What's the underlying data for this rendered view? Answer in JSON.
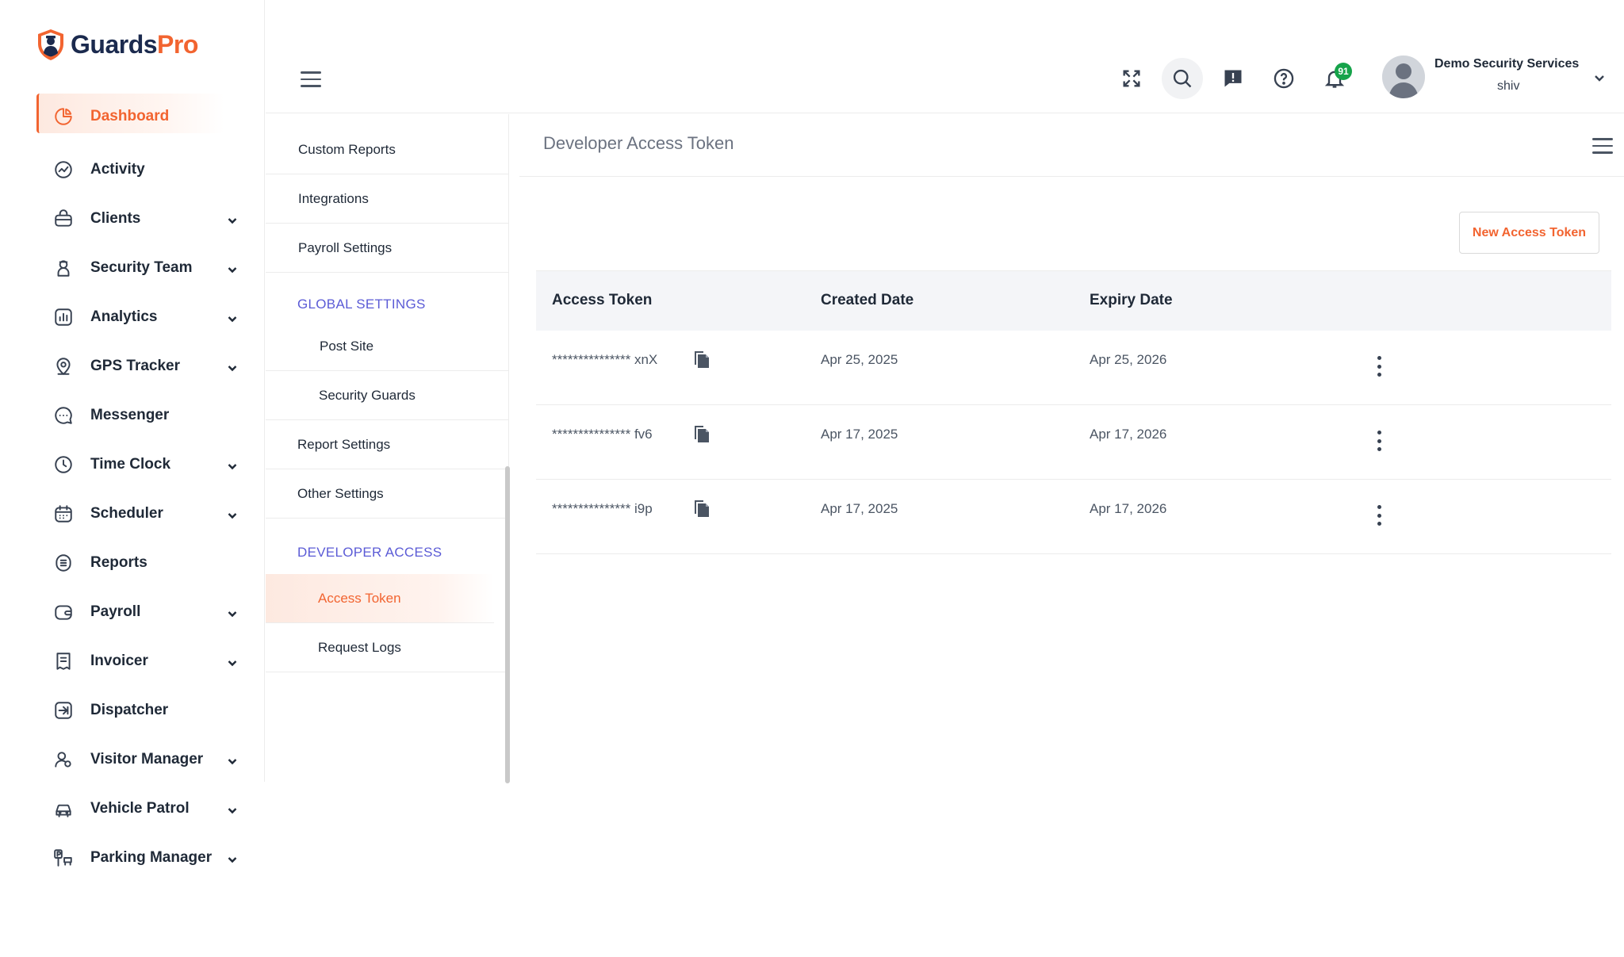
{
  "brand": {
    "name_part1": "Guards",
    "name_part2": "Pro"
  },
  "sidebar": {
    "items": [
      {
        "label": "Dashboard",
        "icon": "dashboard-icon",
        "has_chevron": false,
        "active": true
      },
      {
        "label": "Activity",
        "icon": "activity-icon",
        "has_chevron": false
      },
      {
        "label": "Clients",
        "icon": "clients-icon",
        "has_chevron": true
      },
      {
        "label": "Security Team",
        "icon": "security-team-icon",
        "has_chevron": true
      },
      {
        "label": "Analytics",
        "icon": "analytics-icon",
        "has_chevron": true
      },
      {
        "label": "GPS Tracker",
        "icon": "gps-pin-icon",
        "has_chevron": true
      },
      {
        "label": "Messenger",
        "icon": "chat-bubble-icon",
        "has_chevron": false
      },
      {
        "label": "Time Clock",
        "icon": "clock-icon",
        "has_chevron": true
      },
      {
        "label": "Scheduler",
        "icon": "calendar-icon",
        "has_chevron": true
      },
      {
        "label": "Reports",
        "icon": "report-icon",
        "has_chevron": false
      },
      {
        "label": "Payroll",
        "icon": "wallet-icon",
        "has_chevron": true
      },
      {
        "label": "Invoicer",
        "icon": "invoice-icon",
        "has_chevron": true
      },
      {
        "label": "Dispatcher",
        "icon": "dispatch-icon",
        "has_chevron": false
      },
      {
        "label": "Visitor Manager",
        "icon": "visitor-icon",
        "has_chevron": true
      },
      {
        "label": "Vehicle Patrol",
        "icon": "car-icon",
        "has_chevron": true
      },
      {
        "label": "Parking Manager",
        "icon": "parking-icon",
        "has_chevron": true
      }
    ]
  },
  "header": {
    "user_name": "Demo Security Services",
    "user_sub": "shiv",
    "notification_count": "91"
  },
  "settings_menu": {
    "items_top": [
      "Custom Reports",
      "Integrations",
      "Payroll Settings"
    ],
    "global_heading": "GLOBAL SETTINGS",
    "global_items": [
      "Post Site",
      "Security Guards"
    ],
    "items_mid": [
      "Report Settings",
      "Other Settings"
    ],
    "developer_heading": "DEVELOPER ACCESS",
    "developer_items": [
      "Access Token",
      "Request Logs"
    ],
    "active_item": "Access Token"
  },
  "main": {
    "title": "Developer Access Token",
    "new_button": "New Access Token",
    "columns": [
      "Access Token",
      "Created Date",
      "Expiry Date"
    ],
    "rows": [
      {
        "token": "*************** xnX",
        "created": "Apr 25, 2025",
        "expiry": "Apr 25, 2026"
      },
      {
        "token": "*************** fv6",
        "created": "Apr 17, 2025",
        "expiry": "Apr 17, 2026"
      },
      {
        "token": "*************** i9p",
        "created": "Apr 17, 2025",
        "expiry": "Apr 17, 2026"
      }
    ]
  },
  "colors": {
    "accent": "#f26430",
    "brand_navy": "#1b2a4e",
    "section_heading": "#5b5bd6",
    "badge": "#16a34a"
  }
}
